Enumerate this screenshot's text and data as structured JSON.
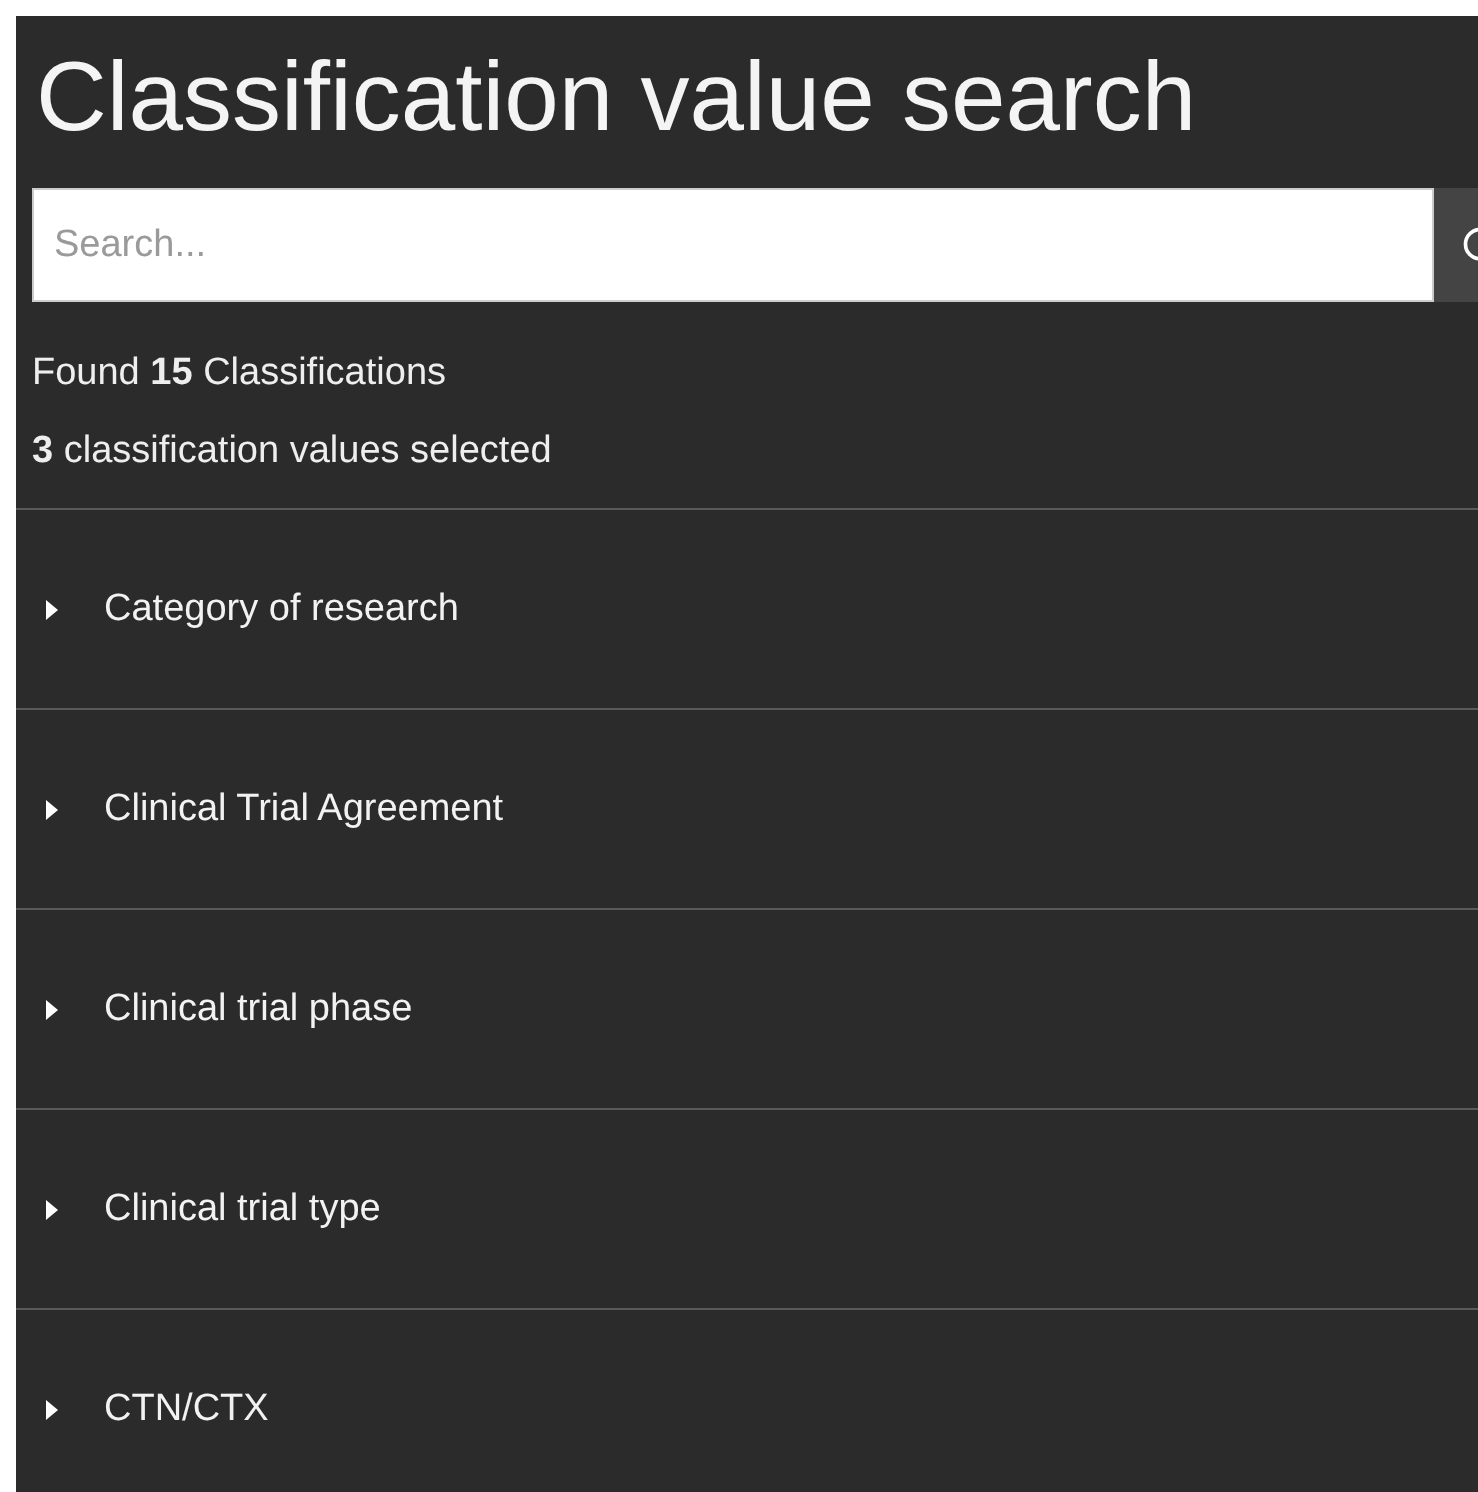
{
  "title": "Classification value search",
  "search": {
    "placeholder": "Search..."
  },
  "summary": [
    "Found **15** Classifications",
    "**3** classification values selected"
  ],
  "groups": [
    {
      "label": "Category of research",
      "expanded": false
    },
    {
      "label": "Clinical Trial Agreement",
      "expanded": false
    },
    {
      "label": "Clinical trial phase",
      "expanded": false
    },
    {
      "label": "Clinical trial type",
      "expanded": false
    },
    {
      "label": "CTN/CTX",
      "expanded": false
    }
  ]
}
